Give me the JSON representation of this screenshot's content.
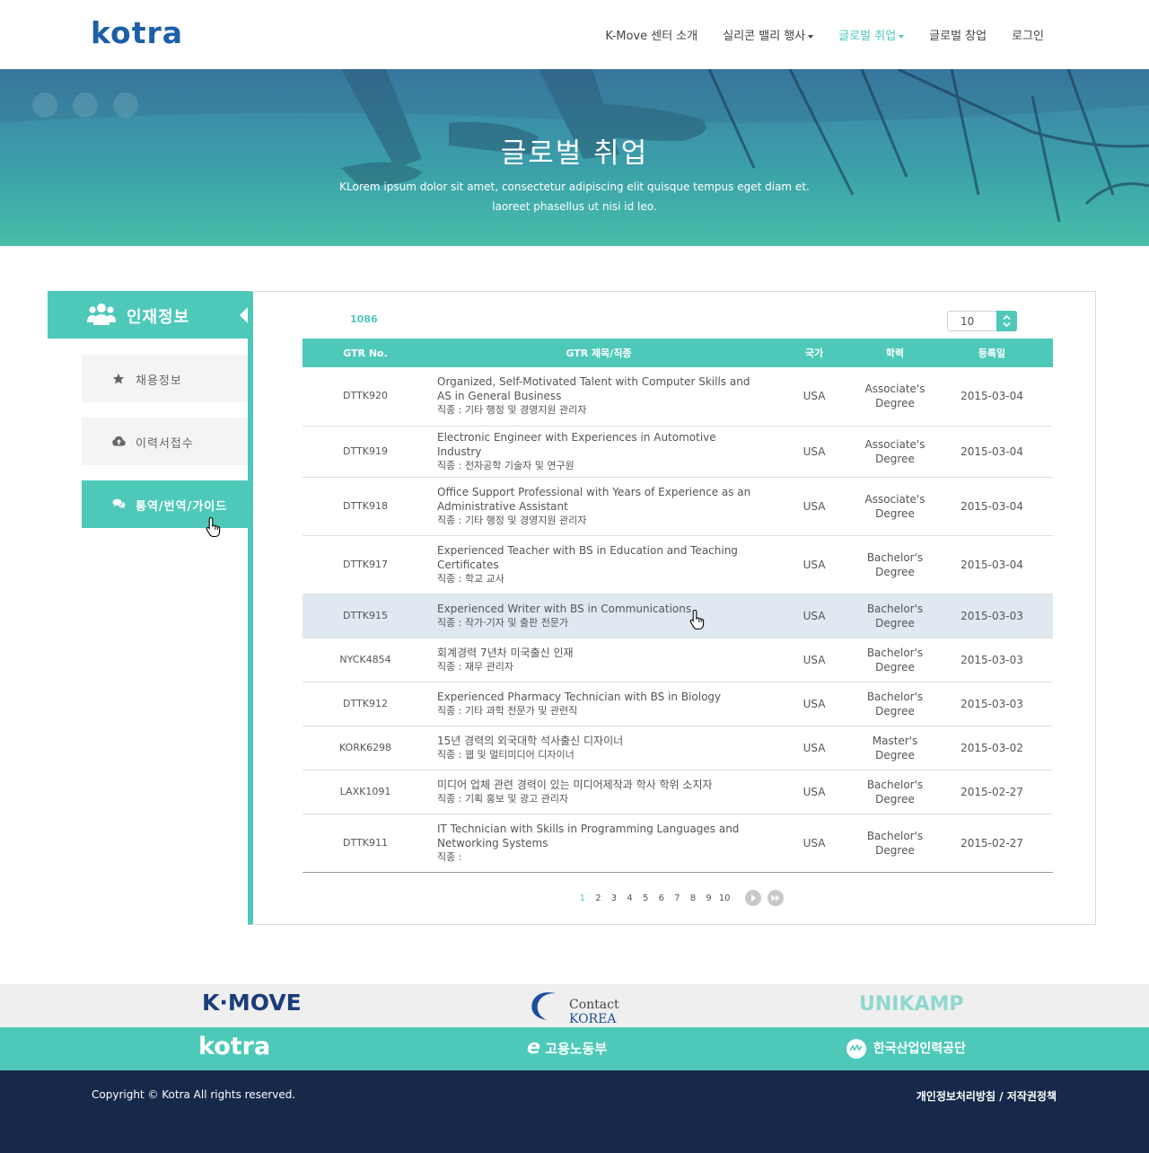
{
  "header": {
    "logo": "kotra",
    "nav": [
      {
        "label": "K-Move 센터 소개",
        "caret": false,
        "active": false
      },
      {
        "label": "실리콘 밸리 행사",
        "caret": true,
        "active": false
      },
      {
        "label": "글로벌 취업",
        "caret": true,
        "active": true
      },
      {
        "label": "글로벌 창업",
        "caret": false,
        "active": false
      },
      {
        "label": "로그인",
        "caret": false,
        "active": false
      }
    ]
  },
  "hero": {
    "title": "글로벌 취업",
    "sub1": "KLorem ipsum dolor sit amet, consectetur adipiscing elit quisque tempus eget diam et.",
    "sub2": "laoreet phasellus ut nisi id leo."
  },
  "sidebar": {
    "heading": "인재정보",
    "items": [
      {
        "label": "채용정보",
        "icon": "star-icon"
      },
      {
        "label": "이력서접수",
        "icon": "cloud-upload-icon"
      },
      {
        "label": "통역/번역/가이드",
        "icon": "chat-bubbles-icon"
      }
    ]
  },
  "list": {
    "total": "1086",
    "per_page": "10",
    "columns": [
      "GTR No.",
      "GTR 제목/직종",
      "국가",
      "학력",
      "등록일"
    ],
    "rows": [
      {
        "no": "DTTK920",
        "title": "Organized, Self-Motivated Talent with Computer Skills and AS in General Business",
        "job": "직종 : 기타 행정 및 경영지원 관리자",
        "country": "USA",
        "edu1": "Associate's",
        "edu2": "Degree",
        "date": "2015-03-04"
      },
      {
        "no": "DTTK919",
        "title": "Electronic Engineer with Experiences in Automotive Industry",
        "job": "직종 : 전자공학 기술자 및 연구원",
        "country": "USA",
        "edu1": "Associate's",
        "edu2": "Degree",
        "date": "2015-03-04"
      },
      {
        "no": "DTTK918",
        "title": "Office Support Professional with Years of Experience as an Administrative Assistant",
        "job": "직종 : 기타 행정 및 경영지원 관리자",
        "country": "USA",
        "edu1": "Associate's",
        "edu2": "Degree",
        "date": "2015-03-04"
      },
      {
        "no": "DTTK917",
        "title": "Experienced Teacher with BS in Education and Teaching Certificates",
        "job": "직종 : 학교 교사",
        "country": "USA",
        "edu1": "Bachelor's",
        "edu2": "Degree",
        "date": "2015-03-04"
      },
      {
        "no": "DTTK915",
        "title": "Experienced Writer with BS in Communications",
        "job": "직종 : 작가·기자 및 출판 전문가",
        "country": "USA",
        "edu1": "Bachelor's",
        "edu2": "Degree",
        "date": "2015-03-03"
      },
      {
        "no": "NYCK4854",
        "title": "회계경력 7년차 미국출신 인재",
        "job": "직종 : 재무 관리자",
        "country": "USA",
        "edu1": "Bachelor's",
        "edu2": "Degree",
        "date": "2015-03-03"
      },
      {
        "no": "DTTK912",
        "title": "Experienced Pharmacy Technician with BS in Biology",
        "job": "직종 : 기타 과학 전문가 및 관련직",
        "country": "USA",
        "edu1": "Bachelor's",
        "edu2": "Degree",
        "date": "2015-03-03"
      },
      {
        "no": "KORK6298",
        "title": "15년 경력의 외국대학 석사출신 디자이너",
        "job": "직종 : 웹 및 멀티미디어 디자이너",
        "country": "USA",
        "edu1": "Master's",
        "edu2": "Degree",
        "date": "2015-03-02"
      },
      {
        "no": "LAXK1091",
        "title": "미디어 업체 관련 경력이 있는 미디어제작과 학사 학위 소지자",
        "job": "직종 : 기획 홍보 및 광고 관리자",
        "country": "USA",
        "edu1": "Bachelor's",
        "edu2": "Degree",
        "date": "2015-02-27"
      },
      {
        "no": "DTTK911",
        "title": "IT Technician with Skills in Programming Languages and Networking Systems",
        "job": "직종 :",
        "country": "USA",
        "edu1": "Bachelor's",
        "edu2": "Degree",
        "date": "2015-02-27"
      }
    ],
    "highlighted_row": 4,
    "pages": [
      "1",
      "2",
      "3",
      "4",
      "5",
      "6",
      "7",
      "8",
      "9",
      "10"
    ],
    "current_page": "1"
  },
  "partners": {
    "row1": [
      "K·MOVE",
      "Contact",
      "KOREA",
      "UNIKAMP"
    ],
    "row2": [
      "kotra",
      "고용노동부",
      "한국산업인력공단"
    ]
  },
  "footer": {
    "copyright": "Copyright © Kotra All rights reserved.",
    "links": "개인정보처리방침 / 저작권정책"
  },
  "colors": {
    "accent": "#4ec9b9",
    "brand": "#1c5fa8",
    "footer": "#17294a",
    "highlight": "#e0e9f2"
  }
}
